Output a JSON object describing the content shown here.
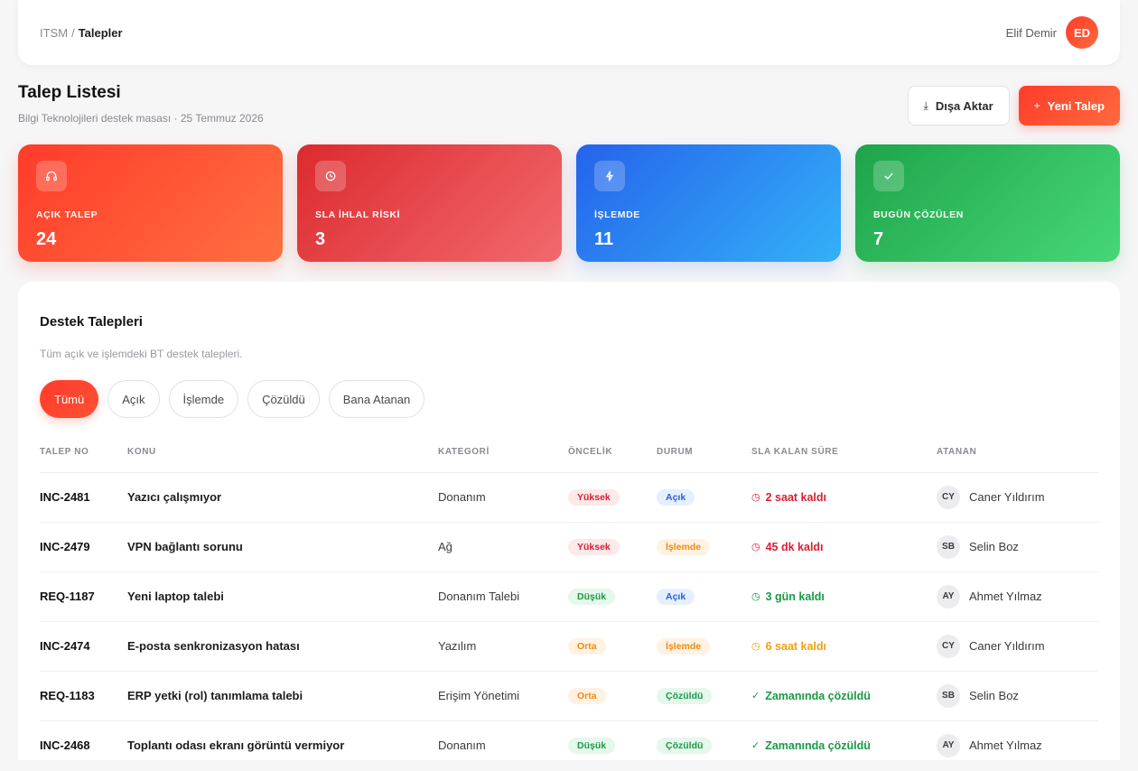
{
  "breadcrumb": {
    "root": "ITSM",
    "separator": "/",
    "current": "Talepler"
  },
  "user": {
    "name": "Elif Demir",
    "initials": "ED"
  },
  "page": {
    "title": "Talep Listesi",
    "subtitle": "Bilgi Teknolojileri destek masası · 25 Temmuz 2026"
  },
  "actions": {
    "export_label": "Dışa Aktar",
    "new_label": "Yeni Talep"
  },
  "stats": [
    {
      "label": "AÇIK TALEP",
      "value": "24",
      "icon": "headset-icon"
    },
    {
      "label": "SLA İHLAL RİSKİ",
      "value": "3",
      "icon": "clock-icon"
    },
    {
      "label": "İŞLEMDE",
      "value": "11",
      "icon": "lightning-icon"
    },
    {
      "label": "BUGÜN ÇÖZÜLEN",
      "value": "7",
      "icon": "check-icon"
    }
  ],
  "panel": {
    "title": "Destek Talepleri",
    "subtitle": "Tüm açık ve işlemdeki BT destek talepleri."
  },
  "filters": [
    "Tümü",
    "Açık",
    "İşlemde",
    "Çözüldü",
    "Bana Atanan"
  ],
  "table": {
    "headers": [
      "TALEP NO",
      "KONU",
      "KATEGORİ",
      "ÖNCELİK",
      "DURUM",
      "SLA KALAN SÜRE",
      "ATANAN"
    ],
    "rows": [
      {
        "id": "INC-2481",
        "subject": "Yazıcı çalışmıyor",
        "category": "Donanım",
        "priority": "Yüksek",
        "status": "Açık",
        "sla": "2 saat kaldı",
        "initials": "CY",
        "assignee": "Caner Yıldırım"
      },
      {
        "id": "INC-2479",
        "subject": "VPN bağlantı sorunu",
        "category": "Ağ",
        "priority": "Yüksek",
        "status": "İşlemde",
        "sla": "45 dk kaldı",
        "initials": "SB",
        "assignee": "Selin Boz"
      },
      {
        "id": "REQ-1187",
        "subject": "Yeni laptop talebi",
        "category": "Donanım Talebi",
        "priority": "Düşük",
        "status": "Açık",
        "sla": "3 gün kaldı",
        "initials": "AY",
        "assignee": "Ahmet Yılmaz"
      },
      {
        "id": "INC-2474",
        "subject": "E-posta senkronizasyon hatası",
        "category": "Yazılım",
        "priority": "Orta",
        "status": "İşlemde",
        "sla": "6 saat kaldı",
        "initials": "CY",
        "assignee": "Caner Yıldırım"
      },
      {
        "id": "REQ-1183",
        "subject": "ERP yetki (rol) tanımlama talebi",
        "category": "Erişim Yönetimi",
        "priority": "Orta",
        "status": "Çözüldü",
        "sla": "Zamanında çözüldü",
        "initials": "SB",
        "assignee": "Selin Boz"
      },
      {
        "id": "INC-2468",
        "subject": "Toplantı odası ekranı görüntü vermiyor",
        "category": "Donanım",
        "priority": "Düşük",
        "status": "Çözüldü",
        "sla": "Zamanında çözüldü",
        "initials": "AY",
        "assignee": "Ahmet Yılmaz"
      }
    ]
  },
  "colors": {
    "accent": "#ff3b2a",
    "danger": "#d92030",
    "success": "#1a9a46",
    "warning": "#f08a10",
    "info": "#2a5fd9"
  }
}
